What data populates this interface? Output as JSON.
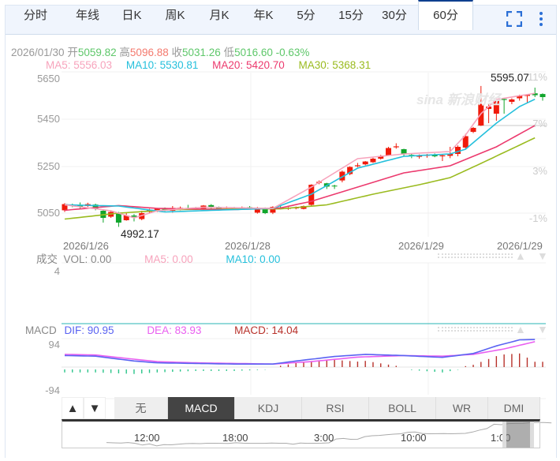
{
  "tabs": [
    "分时",
    "年线",
    "日K",
    "周K",
    "月K",
    "年K",
    "5分",
    "15分",
    "30分",
    "60分"
  ],
  "active_tab": "60分",
  "info": {
    "date": "2026/01/30",
    "open_label": "开",
    "open": "5059.82",
    "high_label": "高",
    "high": "5096.88",
    "close_label": "收",
    "close": "5031.26",
    "low_label": "低",
    "low": "5016.60",
    "change": "-0.63%"
  },
  "ma": {
    "ma5": "MA5: 5556.03",
    "ma10": "MA10: 5530.81",
    "ma20": "MA20: 5420.70",
    "ma30": "MA30: 5368.31"
  },
  "colors": {
    "up": "#f01a0a",
    "down": "#11a52c",
    "ma5": "#f7a3bc",
    "ma10": "#25c0dc",
    "ma20": "#ec3a6e",
    "ma30": "#9abb1f",
    "dif": "#5a63f2",
    "dea": "#e95ff0",
    "macd": "#b8322b"
  },
  "watermark": "sina 新浪财经",
  "chart_data": {
    "type": "candlestick",
    "y_ticks": [
      "5650",
      "5450",
      "5250",
      "5050"
    ],
    "pct_ticks": [
      "11%",
      "7%",
      "3%",
      "-1%"
    ],
    "date_labels": [
      "2026/1/26",
      "2026/1/28",
      "2026/1/29",
      "2026/1/29"
    ],
    "max_label": "5595.07",
    "min_label": "4992.17",
    "candles_ochl": [
      [
        5062,
        5088,
        5092,
        5055
      ],
      [
        5085,
        5080,
        5090,
        5075
      ],
      [
        5082,
        5078,
        5095,
        5070
      ],
      [
        5080,
        5088,
        5094,
        5076
      ],
      [
        5086,
        5070,
        5090,
        5062
      ],
      [
        5060,
        5030,
        5065,
        5010
      ],
      [
        5035,
        5055,
        5062,
        5030
      ],
      [
        5050,
        5010,
        5055,
        4992
      ],
      [
        5020,
        5040,
        5050,
        5018
      ],
      [
        5040,
        5035,
        5046,
        5015
      ],
      [
        5025,
        5050,
        5060,
        5020
      ],
      [
        5055,
        5062,
        5068,
        5048
      ],
      [
        5060,
        5068,
        5072,
        5055
      ],
      [
        5070,
        5062,
        5074,
        5058
      ],
      [
        5060,
        5072,
        5080,
        5052
      ],
      [
        5068,
        5072,
        5078,
        5062
      ],
      [
        5072,
        5070,
        5085,
        5065
      ],
      [
        5070,
        5068,
        5076,
        5064
      ],
      [
        5066,
        5082,
        5084,
        5064
      ],
      [
        5084,
        5074,
        5088,
        5068
      ],
      [
        5072,
        5070,
        5078,
        5062
      ],
      [
        5068,
        5070,
        5078,
        5064
      ],
      [
        5072,
        5070,
        5076,
        5066
      ],
      [
        5070,
        5075,
        5078,
        5066
      ],
      [
        5075,
        5072,
        5080,
        5068
      ],
      [
        5052,
        5072,
        5076,
        5048
      ],
      [
        5072,
        5050,
        5074,
        5046
      ],
      [
        5052,
        5076,
        5079,
        5046
      ],
      [
        5074,
        5070,
        5080,
        5066
      ],
      [
        5068,
        5072,
        5076,
        5064
      ],
      [
        5070,
        5074,
        5078,
        5066
      ],
      [
        5068,
        5080,
        5082,
        5066
      ],
      [
        5085,
        5170,
        5172,
        5080
      ],
      [
        5178,
        5182,
        5188,
        5172
      ],
      [
        5176,
        5162,
        5178,
        5152
      ],
      [
        5166,
        5164,
        5170,
        5152
      ],
      [
        5188,
        5225,
        5230,
        5180
      ],
      [
        5215,
        5245,
        5248,
        5210
      ],
      [
        5248,
        5252,
        5262,
        5244
      ],
      [
        5256,
        5268,
        5270,
        5252
      ],
      [
        5265,
        5280,
        5284,
        5262
      ],
      [
        5280,
        5290,
        5296,
        5276
      ],
      [
        5295,
        5325,
        5330,
        5292
      ],
      [
        5328,
        5332,
        5345,
        5322
      ],
      [
        5320,
        5298,
        5322,
        5288
      ],
      [
        5296,
        5290,
        5300,
        5282
      ],
      [
        5288,
        5292,
        5298,
        5280
      ],
      [
        5292,
        5296,
        5300,
        5284
      ],
      [
        5298,
        5290,
        5302,
        5286
      ],
      [
        5290,
        5294,
        5300,
        5270
      ],
      [
        5292,
        5300,
        5330,
        5282
      ],
      [
        5300,
        5330,
        5336,
        5290
      ],
      [
        5327,
        5375,
        5385,
        5320
      ],
      [
        5393,
        5410,
        5414,
        5388
      ],
      [
        5420,
        5510,
        5587,
        5418
      ],
      [
        5490,
        5500,
        5510,
        5430
      ],
      [
        5470,
        5525,
        5528,
        5440
      ],
      [
        5532,
        5528,
        5535,
        5470
      ],
      [
        5520,
        5530,
        5535,
        5510
      ],
      [
        5535,
        5545,
        5550,
        5525
      ],
      [
        5545,
        5550,
        5552,
        5515
      ],
      [
        5556,
        5548,
        5580,
        5540
      ],
      [
        5553,
        5540,
        5556,
        5525
      ]
    ],
    "ma_points": {
      "ma5": [
        [
          0,
          5085
        ],
        [
          6,
          5060
        ],
        [
          9,
          5030
        ],
        [
          12,
          5060
        ],
        [
          18,
          5075
        ],
        [
          27,
          5070
        ],
        [
          32,
          5160
        ],
        [
          38,
          5280
        ],
        [
          44,
          5300
        ],
        [
          50,
          5310
        ],
        [
          52,
          5380
        ],
        [
          54,
          5470
        ],
        [
          56,
          5530
        ],
        [
          61,
          5556
        ]
      ],
      "ma10": [
        [
          0,
          5085
        ],
        [
          7,
          5080
        ],
        [
          13,
          5055
        ],
        [
          22,
          5065
        ],
        [
          27,
          5070
        ],
        [
          32,
          5130
        ],
        [
          38,
          5240
        ],
        [
          44,
          5290
        ],
        [
          50,
          5300
        ],
        [
          52,
          5320
        ],
        [
          56,
          5430
        ],
        [
          59,
          5500
        ],
        [
          61,
          5531
        ]
      ],
      "ma20": [
        [
          0,
          5062
        ],
        [
          7,
          5082
        ],
        [
          12,
          5070
        ],
        [
          22,
          5065
        ],
        [
          28,
          5072
        ],
        [
          32,
          5100
        ],
        [
          38,
          5160
        ],
        [
          44,
          5220
        ],
        [
          50,
          5250
        ],
        [
          56,
          5330
        ],
        [
          61,
          5420
        ]
      ],
      "ma30": [
        [
          0,
          5025
        ],
        [
          7,
          5050
        ],
        [
          14,
          5065
        ],
        [
          22,
          5068
        ],
        [
          28,
          5068
        ],
        [
          34,
          5085
        ],
        [
          40,
          5130
        ],
        [
          46,
          5170
        ],
        [
          50,
          5200
        ],
        [
          54,
          5260
        ],
        [
          61,
          5368
        ]
      ]
    },
    "macd": {
      "y_ticks": [
        "94",
        "-94"
      ],
      "dif": [
        [
          0,
          38
        ],
        [
          4,
          36
        ],
        [
          9,
          20
        ],
        [
          12,
          14
        ],
        [
          17,
          12
        ],
        [
          22,
          10
        ],
        [
          27,
          10
        ],
        [
          30,
          20
        ],
        [
          35,
          35
        ],
        [
          39,
          42
        ],
        [
          44,
          38
        ],
        [
          49,
          32
        ],
        [
          53,
          45
        ],
        [
          56,
          70
        ],
        [
          59,
          90
        ],
        [
          61,
          91
        ]
      ],
      "dea": [
        [
          0,
          42
        ],
        [
          4,
          40
        ],
        [
          9,
          26
        ],
        [
          12,
          18
        ],
        [
          17,
          14
        ],
        [
          22,
          12
        ],
        [
          27,
          10
        ],
        [
          32,
          18
        ],
        [
          38,
          33
        ],
        [
          44,
          38
        ],
        [
          49,
          36
        ],
        [
          53,
          42
        ],
        [
          57,
          60
        ],
        [
          61,
          84
        ]
      ]
    }
  },
  "vol": {
    "title": "成交",
    "vol": "VOL: 0.00",
    "ma5": "MA5: 0.00",
    "ma10": "MA10: 0.00",
    "ymax": "4"
  },
  "macd_header": {
    "title": "MACD",
    "dif": "DIF: 90.95",
    "dea": "DEA: 83.93",
    "macd": "MACD: 14.04"
  },
  "indicator_buttons": [
    "无",
    "MACD",
    "KDJ",
    "RSI",
    "BOLL",
    "WR",
    "DMI"
  ],
  "active_indicator": "MACD",
  "arrows": {
    "up": "▲",
    "down": "▼"
  },
  "overview": {
    "times": [
      "12:00",
      "18:00",
      "3:00",
      "10:00",
      "1:00"
    ]
  }
}
